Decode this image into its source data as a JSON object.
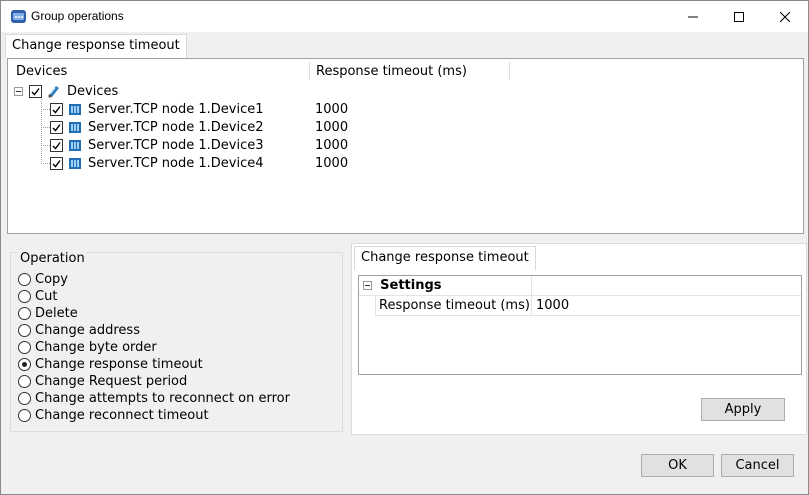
{
  "window": {
    "title": "Group operations"
  },
  "top_tab": {
    "label": "Change response timeout"
  },
  "device_tree": {
    "columns": {
      "devices": "Devices",
      "timeout": "Response timeout (ms)"
    },
    "root": {
      "label": "Devices"
    },
    "items": [
      {
        "label": "Server.TCP node 1.Device1",
        "timeout": "1000"
      },
      {
        "label": "Server.TCP node 1.Device2",
        "timeout": "1000"
      },
      {
        "label": "Server.TCP node 1.Device3",
        "timeout": "1000"
      },
      {
        "label": "Server.TCP node 1.Device4",
        "timeout": "1000"
      }
    ]
  },
  "operation": {
    "group_label": "Operation",
    "options": [
      {
        "label": "Copy",
        "selected": false
      },
      {
        "label": "Cut",
        "selected": false
      },
      {
        "label": "Delete",
        "selected": false
      },
      {
        "label": "Change address",
        "selected": false
      },
      {
        "label": "Change byte order",
        "selected": false
      },
      {
        "label": "Change response timeout",
        "selected": true
      },
      {
        "label": "Change Request period",
        "selected": false
      },
      {
        "label": "Change attempts to reconnect on error",
        "selected": false
      },
      {
        "label": "Change reconnect timeout",
        "selected": false
      }
    ]
  },
  "settings_panel": {
    "tab_label": "Change response timeout",
    "section": "Settings",
    "property_name": "Response timeout (ms)",
    "property_value": "1000",
    "apply_label": "Apply"
  },
  "footer": {
    "ok_label": "OK",
    "cancel_label": "Cancel"
  }
}
